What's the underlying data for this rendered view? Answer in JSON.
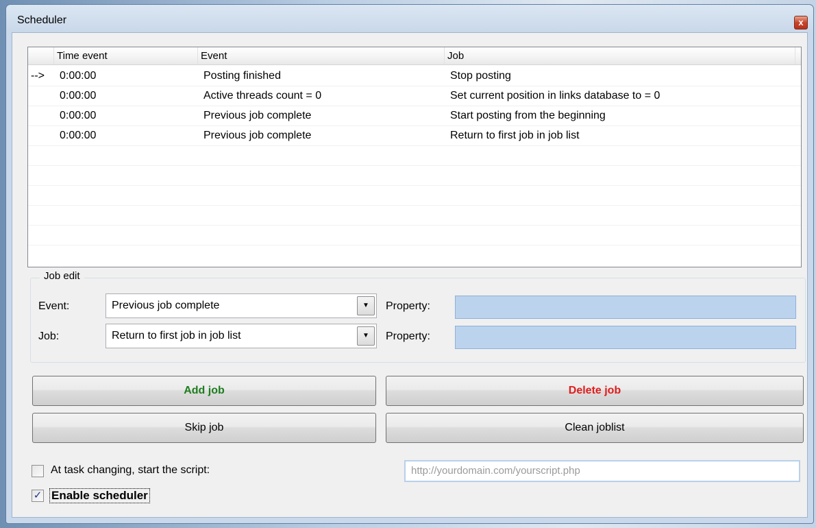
{
  "window": {
    "title": "Scheduler",
    "close_glyph": "x"
  },
  "list": {
    "columns": [
      "Time event",
      "Event",
      "Job"
    ],
    "rows": [
      {
        "marker": "-->",
        "time": "0:00:00",
        "event": "Posting finished",
        "job": "Stop posting"
      },
      {
        "marker": "",
        "time": "0:00:00",
        "event": "Active threads count = 0",
        "job": "Set current position in links database to = 0"
      },
      {
        "marker": "",
        "time": "0:00:00",
        "event": "Previous job complete",
        "job": "Start posting from the beginning"
      },
      {
        "marker": "",
        "time": "0:00:00",
        "event": "Previous job complete",
        "job": "Return to first job in job list"
      }
    ]
  },
  "job_edit": {
    "title": "Job edit",
    "event_label": "Event:",
    "event_value": "Previous job complete",
    "job_label": "Job:",
    "job_value": "Return to first job in job list",
    "property_label": "Property:",
    "dropdown_glyph": "▼"
  },
  "buttons": {
    "add": "Add job",
    "delete": "Delete job",
    "skip": "Skip job",
    "clean": "Clean joblist"
  },
  "options": {
    "script_label": "At task changing, start the script:",
    "script_checked": false,
    "script_placeholder": "http://yourdomain.com/yourscript.php",
    "enable_label": "Enable scheduler",
    "enable_checked": true,
    "check_glyph": "✓"
  },
  "colors": {
    "add": "#1e7d1e",
    "delete": "#e21b1b",
    "property_fill": "#bcd3ee"
  }
}
